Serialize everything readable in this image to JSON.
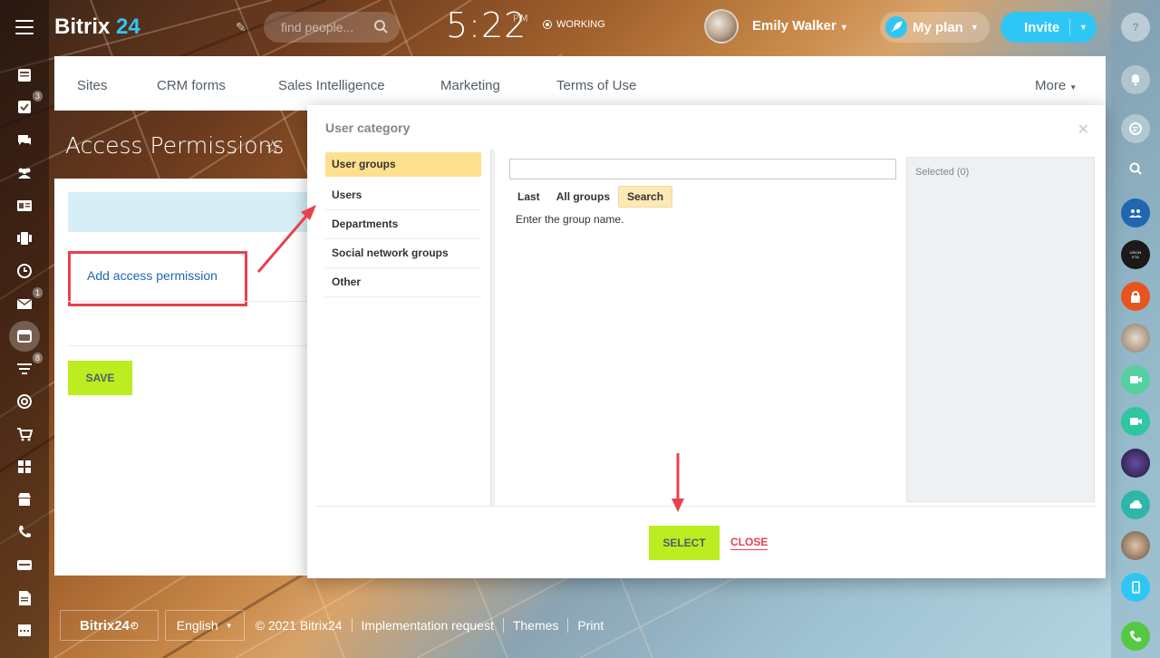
{
  "header": {
    "logo_text": "Bitrix",
    "logo_number": "24",
    "search_placeholder": "find people...",
    "clock_time": "5:22",
    "clock_ampm": "PM",
    "work_status": "WORKING",
    "user_name": "Emily Walker",
    "my_plan_label": "My plan",
    "invite_label": "Invite"
  },
  "nav": {
    "items": [
      "Sites",
      "CRM forms",
      "Sales Intelligence",
      "Marketing",
      "Terms of Use"
    ],
    "more_label": "More"
  },
  "page": {
    "title": "Access Permissions",
    "add_permission_link": "Add access permission",
    "save_label": "SAVE"
  },
  "left_sidebar": {
    "badges": {
      "tasks": "3",
      "mail": "1",
      "filter": "8"
    }
  },
  "dialog": {
    "title": "User category",
    "categories": [
      "User groups",
      "Users",
      "Departments",
      "Social network groups",
      "Other"
    ],
    "selected_category": "User groups",
    "search_value": "",
    "tabs": [
      "Last",
      "All groups",
      "Search"
    ],
    "active_tab": "Search",
    "hint": "Enter the group name.",
    "selected_label": "Selected (0)",
    "select_label": "SELECT",
    "close_label": "CLOSE"
  },
  "footer": {
    "logo_text": "Bitrix24",
    "language": "English",
    "copyright": "© 2021 Bitrix24",
    "links": [
      "Implementation request",
      "Themes",
      "Print"
    ]
  },
  "colors": {
    "accent_blue": "#2fc6f6",
    "button_green": "#bbed21",
    "highlight_red": "#e8414d",
    "selected_yellow": "#fde08d"
  }
}
